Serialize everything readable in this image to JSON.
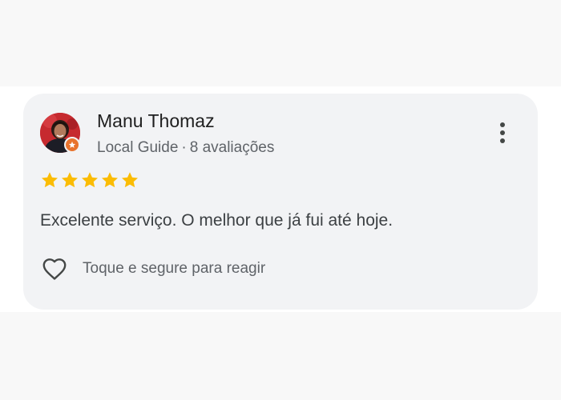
{
  "review": {
    "reviewer": {
      "name": "Manu Thomaz",
      "badge": "Local Guide",
      "separator": "·",
      "review_count": "8 avaliações",
      "avatar_icon": "profile-photo",
      "badge_icon": "local-guide-star-icon"
    },
    "rating": {
      "stars": 5,
      "max": 5,
      "star_color": "#fbbc04"
    },
    "text": "Excelente serviço. O melhor que já fui até hoje.",
    "reaction": {
      "icon": "heart-outline-icon",
      "label": "Toque e segure para reagir"
    },
    "menu_icon": "more-vertical-icon"
  },
  "colors": {
    "card_background": "#f2f3f5",
    "badge_orange": "#e8732d"
  }
}
